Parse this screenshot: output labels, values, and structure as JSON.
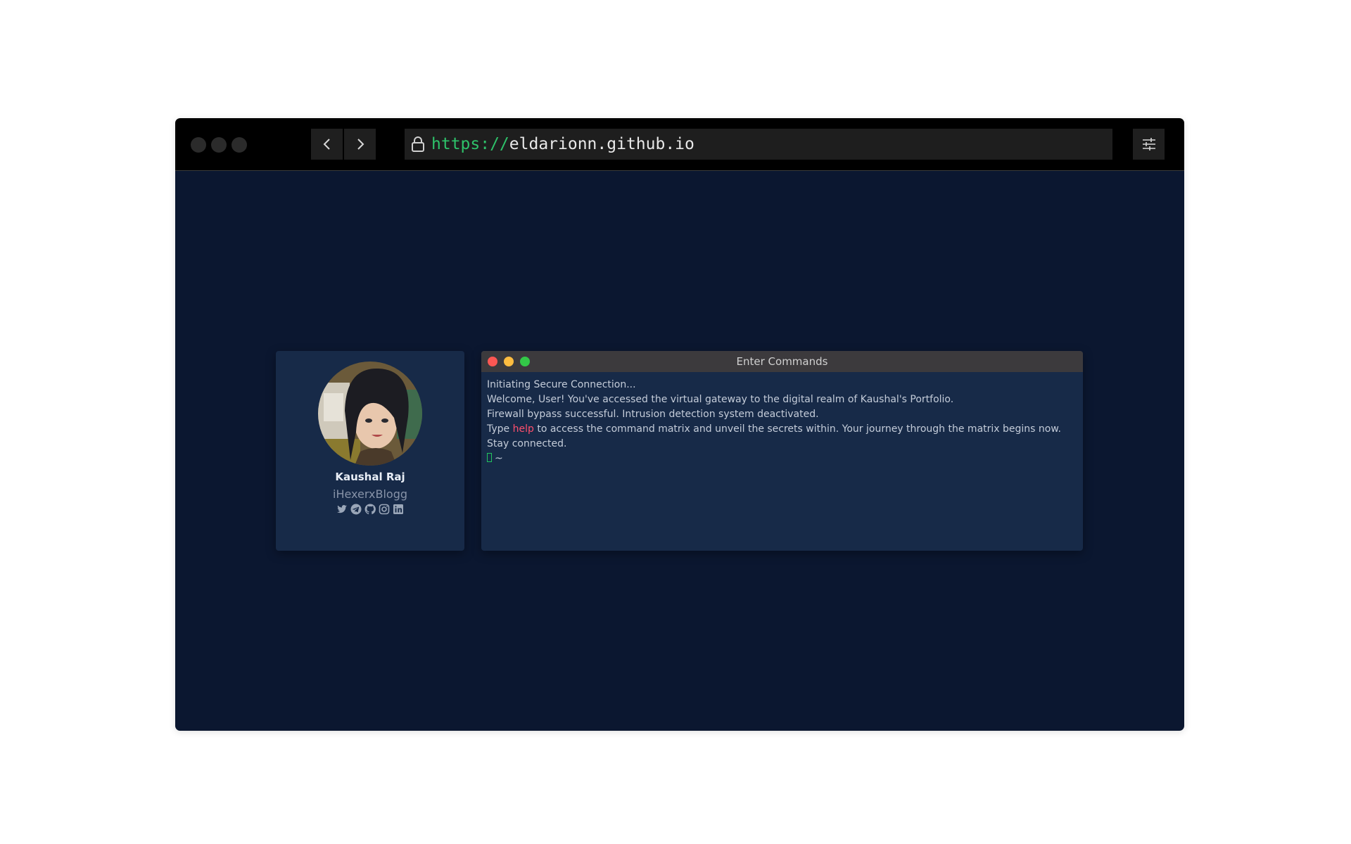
{
  "browser": {
    "url_scheme": "https://",
    "url_host": "eldarionn.github.io",
    "icons": {
      "back": "chevron-left-icon",
      "forward": "chevron-right-icon",
      "lock": "lock-icon",
      "menu": "sliders-icon"
    }
  },
  "profile": {
    "name": "Kaushal Raj",
    "handle": "iHexerxBlogg",
    "socials": [
      "twitter-icon",
      "telegram-icon",
      "github-icon",
      "instagram-icon",
      "linkedin-icon"
    ]
  },
  "terminal": {
    "title": "Enter Commands",
    "lines": {
      "line1": "Initiating Secure Connection...",
      "line2": "Welcome, User! You've accessed the virtual gateway to the digital realm of Kaushal's Portfolio.",
      "line3": "Firewall bypass successful. Intrusion detection system deactivated.",
      "line4_pre": "Type ",
      "line4_help": "help",
      "line4_post": " to access the command matrix and unveil the secrets within. Your journey through the matrix begins now. Stay connected."
    },
    "prompt": "~",
    "input_value": ""
  },
  "colors": {
    "page_bg": "#0b1730",
    "card_bg": "#172a48",
    "url_scheme": "#2ec26a",
    "help_keyword": "#ff4f6d",
    "close": "#fc5753",
    "minimize": "#fdbc40",
    "maximize": "#33c748"
  }
}
